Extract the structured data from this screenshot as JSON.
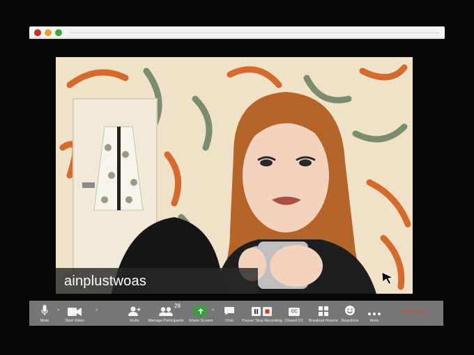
{
  "window": {
    "traffic_lights": {
      "close": "#c8321f",
      "minimize": "#e9a230",
      "zoom": "#41a83b"
    }
  },
  "video": {
    "participant_name": "ainplustwoas"
  },
  "toolbar": {
    "mute_label": "Mute",
    "start_video_label": "Start Video",
    "invite_label": "Invite",
    "manage_participants_label": "Manage Participants",
    "participant_count": "28",
    "share_screen_label": "Share Screen",
    "chat_label": "Chat",
    "recording_label": "Pause/ Stop Recording",
    "closed_cc_label": "Closed CC",
    "cc_icon_text": "CC",
    "breakout_rooms_label": "Breakout Rooms",
    "reactions_label": "Reactions",
    "more_label": "More",
    "end_meeting_label": "End Meeting",
    "share_screen_color": "#36a33a",
    "end_color": "#e23b2e"
  }
}
